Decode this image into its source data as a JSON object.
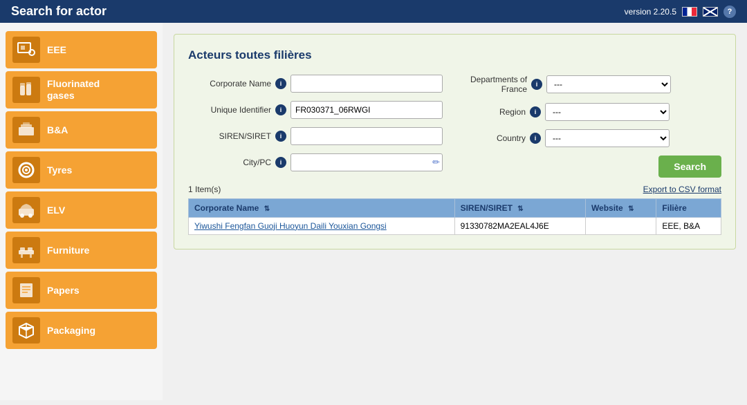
{
  "header": {
    "title": "Search for actor",
    "version": "version 2.20.5",
    "help_icon_label": "?"
  },
  "sidebar": {
    "items": [
      {
        "id": "eee",
        "label": "EEE",
        "icon": "eee-icon"
      },
      {
        "id": "fluorinated-gases",
        "label": "Fluorinated\ngases",
        "icon": "gas-icon"
      },
      {
        "id": "ba",
        "label": "B&A",
        "icon": "ba-icon"
      },
      {
        "id": "tyres",
        "label": "Tyres",
        "icon": "tyres-icon"
      },
      {
        "id": "elv",
        "label": "ELV",
        "icon": "elv-icon"
      },
      {
        "id": "furniture",
        "label": "Furniture",
        "icon": "furniture-icon"
      },
      {
        "id": "papers",
        "label": "Papers",
        "icon": "papers-icon"
      },
      {
        "id": "packaging",
        "label": "Packaging",
        "icon": "packaging-icon"
      }
    ]
  },
  "content": {
    "section_title": "Acteurs toutes filières",
    "form": {
      "corporate_name_label": "Corporate Name",
      "unique_identifier_label": "Unique Identifier",
      "siren_siret_label": "SIREN/SIRET",
      "city_pc_label": "City/PC",
      "departments_label": "Departments of\nFrance",
      "region_label": "Region",
      "country_label": "Country",
      "unique_identifier_value": "FR030371_06RWGI",
      "corporate_name_value": "",
      "siren_siret_value": "",
      "city_pc_value": "",
      "departments_default": "---",
      "region_default": "---",
      "country_default": "---",
      "search_button": "Search"
    },
    "results": {
      "count_text": "1 Item(s)",
      "export_text": "Export to CSV format",
      "columns": [
        {
          "id": "corporate_name",
          "label": "Corporate Name"
        },
        {
          "id": "siren_siret",
          "label": "SIREN/SIRET"
        },
        {
          "id": "website",
          "label": "Website"
        },
        {
          "id": "filiere",
          "label": "Filière"
        }
      ],
      "rows": [
        {
          "corporate_name": "Yiwushi Fengfan Guoji Huoyun Daili Youxian Gongsi",
          "siren_siret": "91330782MA2EAL4J6E",
          "website": "",
          "filiere": "EEE, B&A"
        }
      ]
    }
  }
}
